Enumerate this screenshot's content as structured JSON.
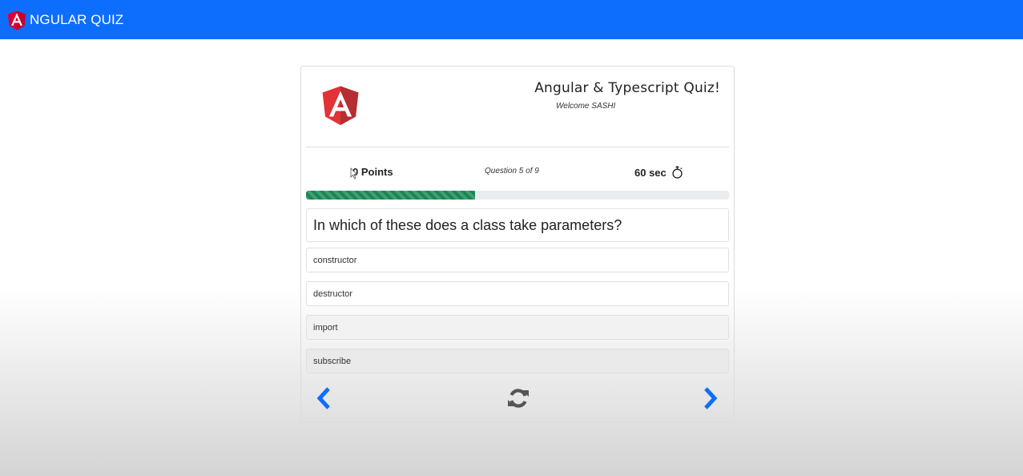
{
  "navbar": {
    "logo_icon": "angular-logo-icon",
    "title": "NGULAR QUIZ",
    "background": "#0d6efd"
  },
  "card": {
    "logo_icon": "angular-shield-icon",
    "title": "Angular & Typescript Quiz!",
    "welcome": "Welcome SASHI"
  },
  "stats": {
    "points": "0 Points",
    "question_counter": "Question 5 of 9",
    "timer": "60 sec",
    "timer_icon": "stopwatch-icon"
  },
  "progress": {
    "fraction": 0.4,
    "color": "#198754"
  },
  "question": {
    "text": "In which of these does a class take parameters?"
  },
  "options": [
    {
      "label": "constructor"
    },
    {
      "label": "destructor"
    },
    {
      "label": "import"
    },
    {
      "label": "subscribe"
    }
  ],
  "controls": {
    "prev_icon": "chevron-left-icon",
    "refresh_icon": "refresh-icon",
    "next_icon": "chevron-right-icon",
    "accent": "#0d6efd"
  }
}
